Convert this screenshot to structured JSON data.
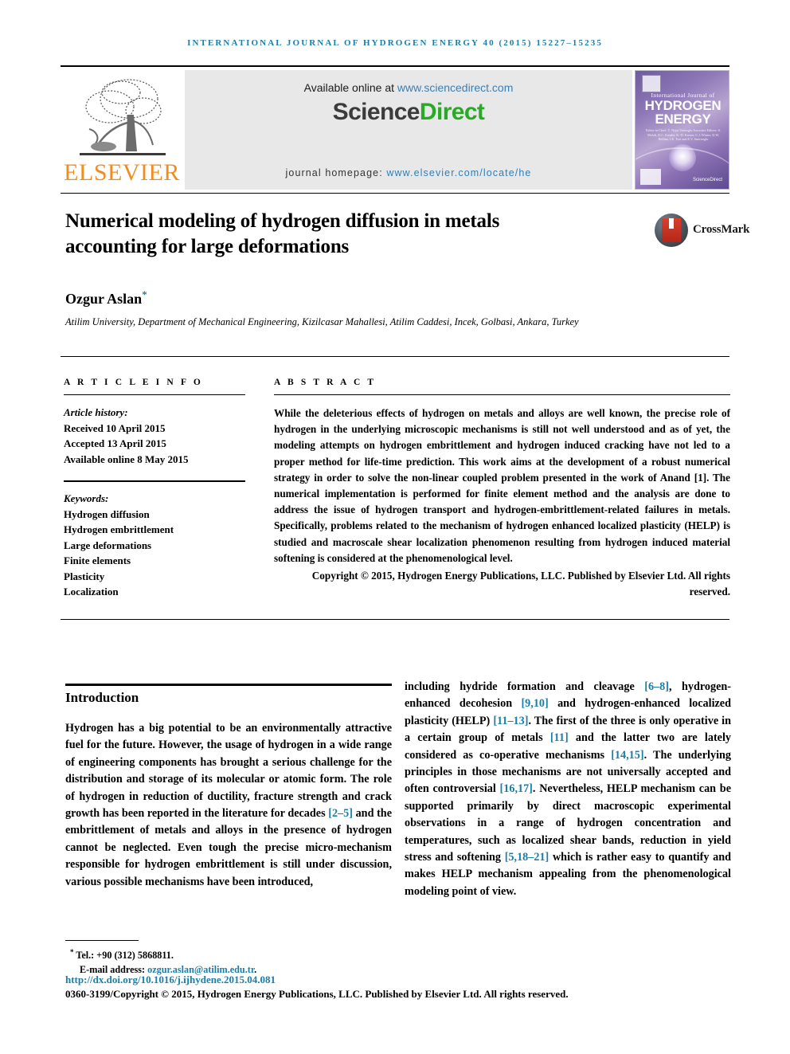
{
  "running_head": "International Journal of Hydrogen Energy 40 (2015) 15227–15235",
  "masthead": {
    "available_prefix": "Available online at ",
    "available_url": "www.sciencedirect.com",
    "logo_part1": "Science",
    "logo_part2": "Direct",
    "homepage_prefix": "journal homepage: ",
    "homepage_url": "www.elsevier.com/locate/he",
    "publisher_name": "ELSEVIER",
    "cover": {
      "subtitle": "International Journal of",
      "title_line1": "HYDROGEN",
      "title_line2": "ENERGY",
      "editors": "Editor-in-Chief: T. Nejat Veziroglu    Associate Editors: S. Mehdi, D.C. Erenler, K.-D. Kreuer, C.J. Winter, D.W. Bellino, I.E. Tsoi and E.V. Smirnoglu",
      "sciencedirect_mark": "ScienceDirect"
    }
  },
  "article": {
    "title": "Numerical modeling of hydrogen diffusion in metals accounting for large deformations",
    "crossmark_label": "CrossMark",
    "author": "Ozgur Aslan",
    "author_marker": "*",
    "affiliation": "Atilim University, Department of Mechanical Engineering, Kizilcasar Mahallesi, Atilim Caddesi, Incek, Golbasi, Ankara, Turkey"
  },
  "article_info": {
    "section_label": "A R T I C L E   I N F O",
    "history_heading": "Article history:",
    "history": [
      "Received 10 April 2015",
      "Accepted 13 April 2015",
      "Available online 8 May 2015"
    ],
    "keywords_heading": "Keywords:",
    "keywords": [
      "Hydrogen diffusion",
      "Hydrogen embrittlement",
      "Large deformations",
      "Finite elements",
      "Plasticity",
      "Localization"
    ]
  },
  "abstract": {
    "section_label": "A B S T R A C T",
    "text": "While the deleterious effects of hydrogen on metals and alloys are well known, the precise role of hydrogen in the underlying microscopic mechanisms is still not well understood and as of yet, the modeling attempts on hydrogen embrittlement and hydrogen induced cracking have not led to a proper method for life-time prediction. This work aims at the development of a robust numerical strategy in order to solve the non-linear coupled problem presented in the work of Anand [1]. The numerical implementation is performed for finite element method and the analysis are done to address the issue of hydrogen transport and hydrogen-embrittlement-related failures in metals. Specifically, problems related to the mechanism of hydrogen enhanced localized plasticity (HELP) is studied and macroscale shear localization phenomenon resulting from hydrogen induced material softening is considered at the phenomenological level.",
    "copyright": "Copyright © 2015, Hydrogen Energy Publications, LLC. Published by Elsevier Ltd. All rights reserved."
  },
  "body": {
    "intro_heading": "Introduction",
    "left_paragraph_1": "Hydrogen has a big potential to be an environmentally attractive fuel for the future. However, the usage of hydrogen in a wide range of engineering components has brought a serious challenge for the distribution and storage of its molecular or atomic form. The role of hydrogen in reduction of ductility, fracture strength and crack growth has been reported in the literature for decades ",
    "left_cite_1": "[2–5]",
    "left_paragraph_2": " and the embrittlement of metals and alloys in the presence of hydrogen cannot be neglected. Even tough the precise micro-mechanism responsible for hydrogen embrittlement is still under discussion, various possible mechanisms have been introduced,",
    "right_segments": [
      {
        "text": "including hydride formation and cleavage ",
        "cite": false
      },
      {
        "text": "[6–8]",
        "cite": true
      },
      {
        "text": ", hydrogen-enhanced decohesion ",
        "cite": false
      },
      {
        "text": "[9,10]",
        "cite": true
      },
      {
        "text": " and hydrogen-enhanced localized plasticity (HELP) ",
        "cite": false
      },
      {
        "text": "[11–13]",
        "cite": true
      },
      {
        "text": ". The first of the three is only operative in a certain group of metals ",
        "cite": false
      },
      {
        "text": "[11]",
        "cite": true
      },
      {
        "text": " and the latter two are lately considered as co-operative mechanisms ",
        "cite": false
      },
      {
        "text": "[14,15]",
        "cite": true
      },
      {
        "text": ". The underlying principles in those mechanisms are not universally accepted and often controversial ",
        "cite": false
      },
      {
        "text": "[16,17]",
        "cite": true
      },
      {
        "text": ". Nevertheless, HELP mechanism can be supported primarily by direct macroscopic experimental observations in a range of hydrogen concentration and temperatures, such as localized shear bands, reduction in yield stress and softening ",
        "cite": false
      },
      {
        "text": "[5,18–21]",
        "cite": true
      },
      {
        "text": " which is rather easy to quantify and makes HELP mechanism appealing from the phenomenological modeling point of view.",
        "cite": false
      }
    ]
  },
  "footer": {
    "tel_marker": "*",
    "tel": " Tel.: +90 (312) 5868811.",
    "email_label": "E-mail address: ",
    "email": "ozgur.aslan@atilim.edu.tr",
    "email_suffix": ".",
    "doi": "http://dx.doi.org/10.1016/j.ijhydene.2015.04.081",
    "issn": "0360-3199/Copyright © 2015, Hydrogen Energy Publications, LLC. Published by Elsevier Ltd. All rights reserved."
  },
  "colors": {
    "link": "#1a7fa8",
    "sciencedirect_green": "#2aa828",
    "elsevier_orange": "#f08c22"
  }
}
